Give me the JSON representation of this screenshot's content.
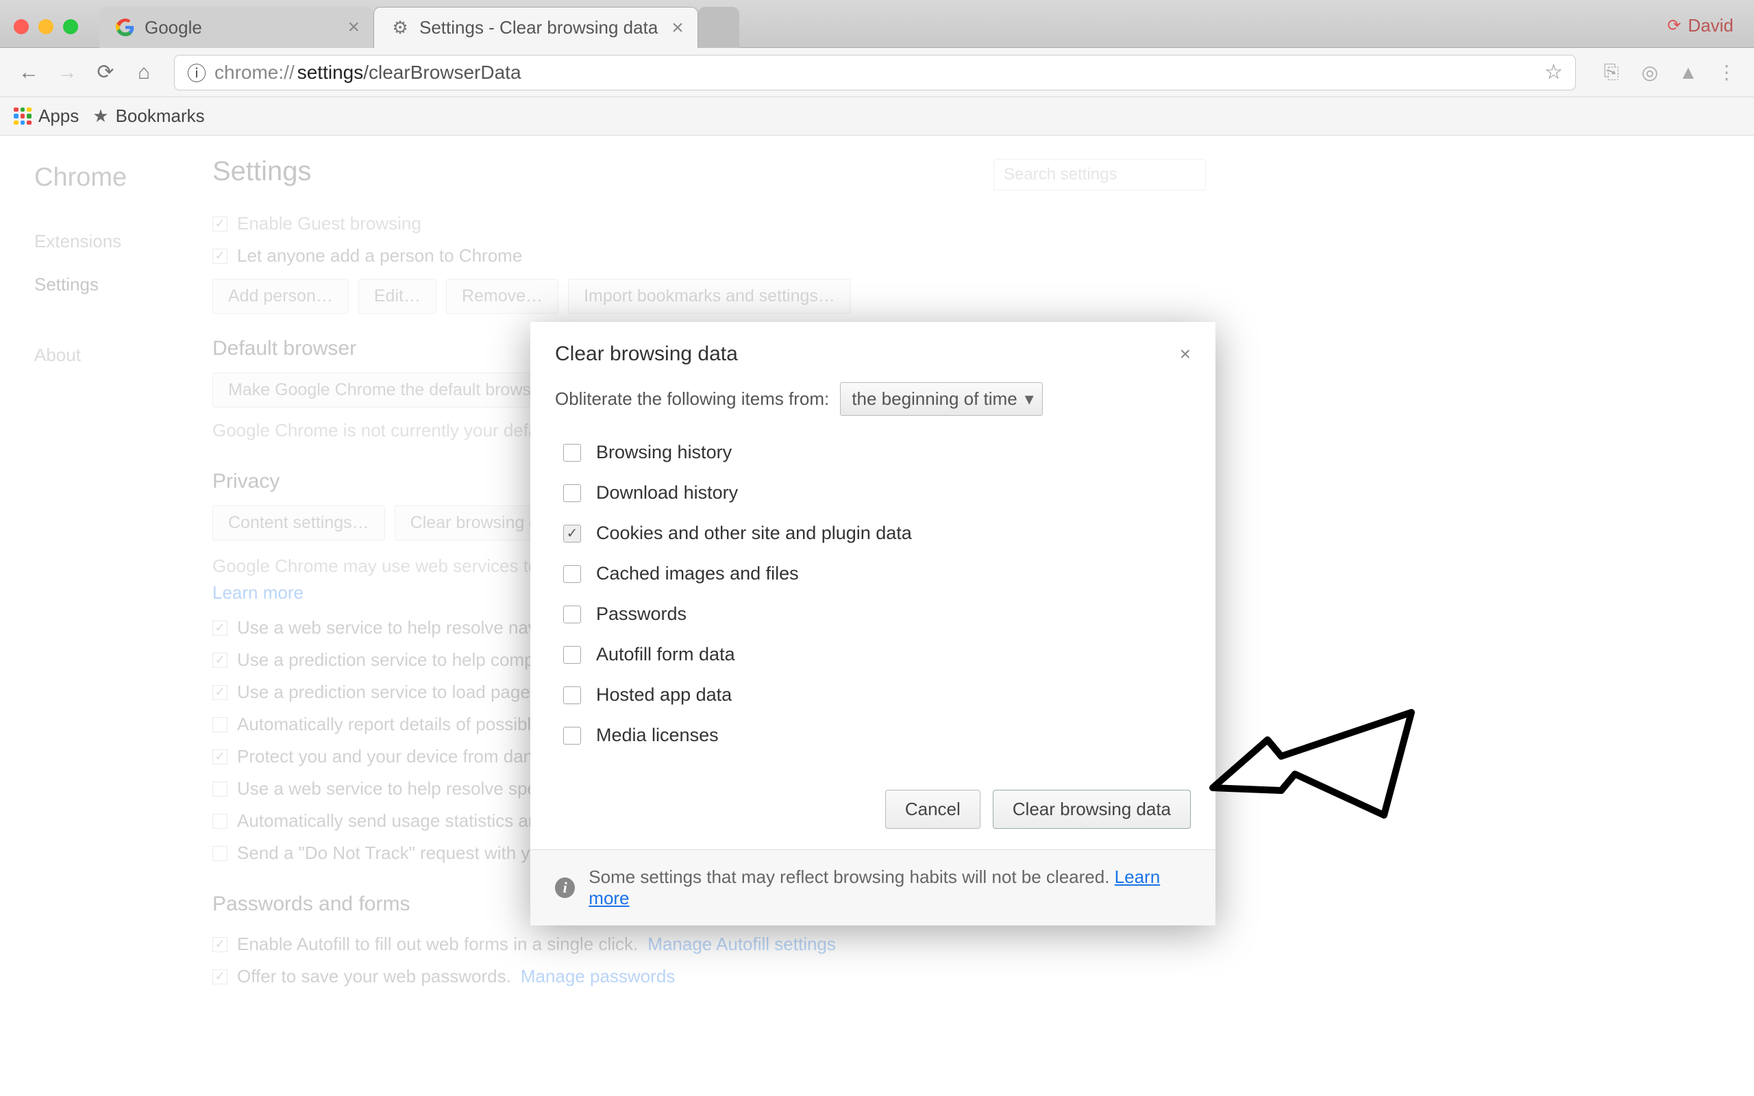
{
  "titlebar": {
    "user": "David",
    "tabs": [
      {
        "label": "Google",
        "active": false
      },
      {
        "label": "Settings - Clear browsing data",
        "active": true
      }
    ]
  },
  "toolbar": {
    "url_prefix": "chrome://",
    "url_bold": "settings",
    "url_rest": "/clearBrowserData"
  },
  "bookmarks_bar": {
    "apps": "Apps",
    "bookmarks": "Bookmarks"
  },
  "sidebar": {
    "brand": "Chrome",
    "items": [
      "Extensions",
      "Settings",
      "About"
    ],
    "active_index": 1
  },
  "settings": {
    "heading": "Settings",
    "search_placeholder": "Search settings",
    "people": {
      "rows": [
        {
          "checked": true,
          "label": "Enable Guest browsing"
        },
        {
          "checked": true,
          "label": "Let anyone add a person to Chrome"
        }
      ],
      "buttons": [
        "Add person…",
        "Edit…",
        "Remove…",
        "Import bookmarks and settings…"
      ]
    },
    "default_browser": {
      "heading": "Default browser",
      "button": "Make Google Chrome the default browser",
      "note": "Google Chrome is not currently your default browser."
    },
    "privacy": {
      "heading": "Privacy",
      "buttons": [
        "Content settings…",
        "Clear browsing data…"
      ],
      "note_prefix": "Google Chrome may use web services to improve your browsing experience. You may optionally disable these services. ",
      "learn_more": "Learn more",
      "rows": [
        {
          "checked": true,
          "label": "Use a web service to help resolve navigation errors"
        },
        {
          "checked": true,
          "label": "Use a prediction service to help complete searches and URLs typed in the address bar"
        },
        {
          "checked": true,
          "label": "Use a prediction service to load pages more quickly"
        },
        {
          "checked": false,
          "label": "Automatically report details of possible security incidents to Google"
        },
        {
          "checked": true,
          "label": "Protect you and your device from dangerous sites"
        },
        {
          "checked": false,
          "label": "Use a web service to help resolve spelling errors"
        },
        {
          "checked": false,
          "label": "Automatically send usage statistics and crash reports to Google"
        },
        {
          "checked": false,
          "label": "Send a \"Do Not Track\" request with your browsing traffic"
        }
      ]
    },
    "passwords": {
      "heading": "Passwords and forms",
      "rows": [
        {
          "checked": true,
          "label": "Enable Autofill to fill out web forms in a single click.",
          "link": "Manage Autofill settings"
        },
        {
          "checked": true,
          "label": "Offer to save your web passwords.",
          "link": "Manage passwords"
        }
      ]
    }
  },
  "modal": {
    "title": "Clear browsing data",
    "obliterate_label": "Obliterate the following items from:",
    "obliterate_value": "the beginning of time",
    "options": [
      {
        "checked": false,
        "label": "Browsing history"
      },
      {
        "checked": false,
        "label": "Download history"
      },
      {
        "checked": true,
        "label": "Cookies and other site and plugin data"
      },
      {
        "checked": false,
        "label": "Cached images and files"
      },
      {
        "checked": false,
        "label": "Passwords"
      },
      {
        "checked": false,
        "label": "Autofill form data"
      },
      {
        "checked": false,
        "label": "Hosted app data"
      },
      {
        "checked": false,
        "label": "Media licenses"
      }
    ],
    "cancel": "Cancel",
    "confirm": "Clear browsing data",
    "info": "Some settings that may reflect browsing habits will not be cleared.",
    "info_link": "Learn more"
  }
}
